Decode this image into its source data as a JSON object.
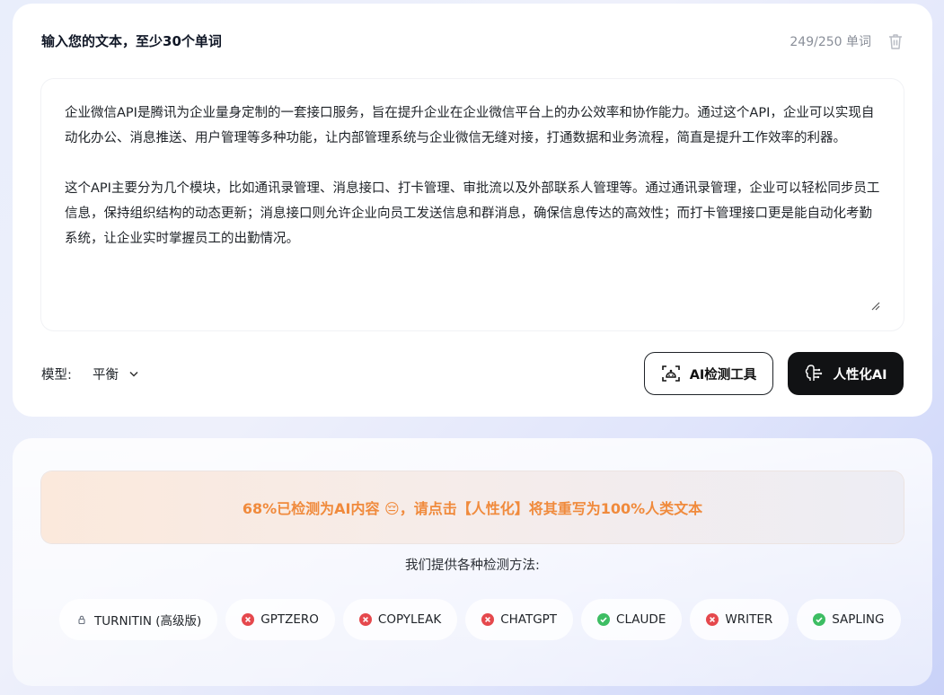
{
  "input": {
    "title": "输入您的文本，至少30个单词",
    "word_count": "249/250 单词",
    "paragraphs": [
      "企业微信API是腾讯为企业量身定制的一套接口服务，旨在提升企业在企业微信平台上的办公效率和协作能力。通过这个API，企业可以实现自动化办公、消息推送、用户管理等多种功能，让内部管理系统与企业微信无缝对接，打通数据和业务流程，简直是提升工作效率的利器。",
      "这个API主要分为几个模块，比如通讯录管理、消息接口、打卡管理、审批流以及外部联系人管理等。通过通讯录管理，企业可以轻松同步员工信息，保持组织结构的动态更新；消息接口则允许企业向员工发送信息和群消息，确保信息传达的高效性；而打卡管理接口更是能自动化考勤系统，让企业实时掌握员工的出勤情况。"
    ]
  },
  "controls": {
    "model_label": "模型:",
    "model_value": "平衡",
    "detect_button": "AI检测工具",
    "humanize_button": "人性化AI"
  },
  "result": {
    "alert": "68%已检测为AI内容 😔，请点击【人性化】将其重写为100%人类文本",
    "alert_color": "#f08a3c",
    "methods_label": "我们提供各种检测方法:",
    "methods": [
      {
        "label": "TURNITIN (高级版)",
        "status": "locked",
        "icon": "lock-icon"
      },
      {
        "label": "GPTZERO",
        "status": "fail",
        "icon": "x-circle-icon"
      },
      {
        "label": "COPYLEAK",
        "status": "fail",
        "icon": "x-circle-icon"
      },
      {
        "label": "CHATGPT",
        "status": "fail",
        "icon": "x-circle-icon"
      },
      {
        "label": "CLAUDE",
        "status": "pass",
        "icon": "check-circle-icon"
      },
      {
        "label": "WRITER",
        "status": "fail",
        "icon": "x-circle-icon"
      },
      {
        "label": "SAPLING",
        "status": "pass",
        "icon": "check-circle-icon"
      }
    ],
    "colors": {
      "fail": "#e5484d",
      "pass": "#3dbd63",
      "lock": "#6b7280"
    }
  }
}
